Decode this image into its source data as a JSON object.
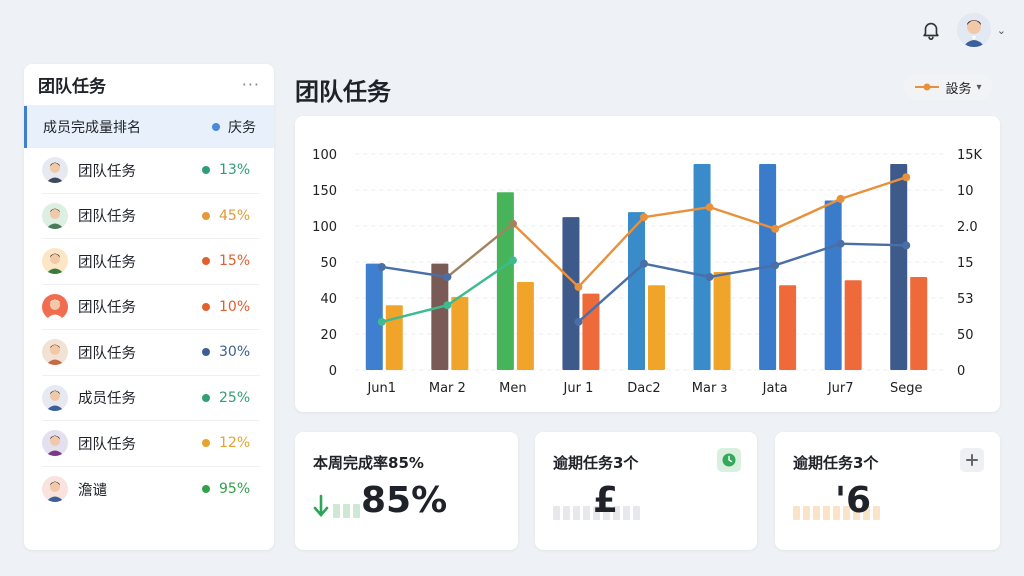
{
  "header": {
    "notification_icon": "bell-icon",
    "avatar_icon": "user-avatar"
  },
  "sidebar": {
    "title": "团队任务",
    "more_label": "···",
    "sub_header": {
      "label": "成员完成量排名",
      "right_label": "庆务",
      "dot_color": "#4a88d8"
    },
    "members": [
      {
        "name": "团队任务",
        "value": "13%",
        "color": "#2e9e7a",
        "avatar_bg": "#e6eaf0"
      },
      {
        "name": "团队任务",
        "value": "45%",
        "color": "#e49a3a",
        "avatar_bg": "#dcefe3"
      },
      {
        "name": "团队任务",
        "value": "15%",
        "color": "#e0602e",
        "avatar_bg": "#fbe7c6"
      },
      {
        "name": "团队任务",
        "value": "10%",
        "color": "#e0602e",
        "avatar_bg": "#f26d4f"
      },
      {
        "name": "团队任务",
        "value": "30%",
        "color": "#3d5f8f",
        "avatar_bg": "#f2e2d3"
      },
      {
        "name": "成员任务",
        "value": "25%",
        "color": "#33a070",
        "avatar_bg": "#e6eaf0"
      },
      {
        "name": "团队任务",
        "value": "12%",
        "color": "#e7a32d",
        "avatar_bg": "#e4e0f0"
      },
      {
        "name": "澹谴",
        "value": "95%",
        "color": "#33a04a",
        "avatar_bg": "#f9e3dc"
      }
    ]
  },
  "main": {
    "title": "团队任务",
    "legend_label": "設务"
  },
  "chart_data": {
    "type": "bar",
    "categories": [
      "Jun1",
      "Mar 2",
      "Men",
      "Jur 1",
      "Dac2",
      "Mar з",
      "Jata",
      "Jur7",
      "Sege"
    ],
    "left_ticks": [
      "100",
      "150",
      "100",
      "50",
      "40",
      "20",
      "0"
    ],
    "right_ticks": [
      "15K",
      "10",
      "2.0",
      "15",
      "53",
      "50",
      "0"
    ],
    "ylim": [
      0,
      130
    ],
    "bar_series_a": {
      "values": [
        64,
        64,
        107,
        92,
        95,
        124,
        124,
        102,
        124
      ],
      "colors": [
        "#3f7fd0",
        "#7a5a55",
        "#47b45a",
        "#3d5a8a",
        "#3a8bc9",
        "#3a8bc9",
        "#3a7cc9",
        "#3a7cc9",
        "#3d5a8a"
      ]
    },
    "bar_series_b": {
      "values": [
        39,
        44,
        53,
        46,
        51,
        59,
        51,
        54,
        56
      ],
      "colors": [
        "#f0a52a",
        "#f0a52a",
        "#f0a52a",
        "#ee6a3a",
        "#f0a52a",
        "#f0a52a",
        "#ee6a3a",
        "#ee6a3a",
        "#ee6a3a"
      ]
    },
    "line_series": [
      {
        "color": "#e8913a",
        "values": [
          null,
          null,
          88,
          50,
          92,
          98,
          85,
          103,
          116
        ]
      },
      {
        "color": "#a0845f",
        "values": [
          null,
          56,
          88,
          null,
          null,
          null,
          null,
          null,
          null
        ]
      },
      {
        "color": "#4a6fa8",
        "values": [
          62,
          56,
          null,
          29,
          64,
          56,
          63,
          76,
          75
        ]
      },
      {
        "color": "#3dbb8f",
        "values": [
          29,
          39,
          66,
          null,
          null,
          null,
          null,
          null,
          null
        ]
      }
    ]
  },
  "kpis": [
    {
      "title": "本周完成率85%",
      "value": "85%",
      "icon": "arrow-down-icon",
      "bar_colors": [
        "#cfe8d6",
        "#cfe8d6",
        "#cfe8d6"
      ]
    },
    {
      "title": "逾期任务3个",
      "value": "£",
      "icon": "clock-icon",
      "icon_bg": "#d8f0dd",
      "bar_colors": [
        "#e6e8ec",
        "#e6e8ec",
        "#e6e8ec",
        "#e6e8ec",
        "#e6e8ec",
        "#e6e8ec",
        "#e6e8ec",
        "#e6e8ec",
        "#e6e8ec"
      ]
    },
    {
      "title": "逾期任务3个",
      "value": "'6",
      "icon": "plus-icon",
      "icon_bg": "#eef0f3",
      "bar_colors": [
        "#fbe3c8",
        "#fbe3c8",
        "#fbe3c8",
        "#fbe3c8",
        "#fbe3c8",
        "#fbe3c8",
        "#fbe3c8",
        "#fbe3c8",
        "#fbe3c8"
      ]
    }
  ]
}
